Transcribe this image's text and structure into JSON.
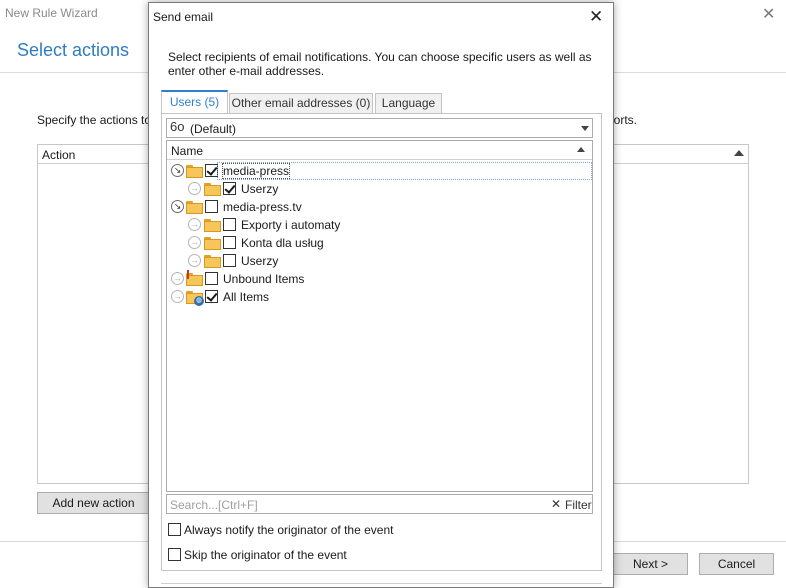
{
  "wizard": {
    "title": "New Rule Wizard",
    "heading": "Select actions",
    "description": "Specify the actions to c",
    "description_tail": "ports.",
    "list_column": "Action",
    "add_button": "Add new action",
    "next_button": "Next >",
    "cancel_button": "Cancel"
  },
  "dialog": {
    "title": "Send email",
    "description": "Select recipients of email notifications. You can choose specific users as well as enter other e-mail addresses.",
    "tabs": [
      {
        "label": "Users (5)",
        "active": true
      },
      {
        "label": "Other email addresses (0)",
        "active": false
      },
      {
        "label": "Language",
        "active": false
      }
    ],
    "profile_selected": "(Default)",
    "tree_column": "Name",
    "tree": [
      {
        "label": "media-press",
        "checked": true,
        "selected": true
      },
      {
        "label": "Userzy",
        "checked": true
      },
      {
        "label": "media-press.tv",
        "checked": false
      },
      {
        "label": "Exporty i automaty",
        "checked": false
      },
      {
        "label": "Konta dla usług",
        "checked": false
      },
      {
        "label": "Userzy",
        "checked": false
      },
      {
        "label": "Unbound Items",
        "checked": false
      },
      {
        "label": "All Items",
        "checked": true
      }
    ],
    "search_placeholder": "Search...[Ctrl+F]",
    "filter_label": "Filter",
    "options": [
      {
        "label": "Always notify the originator of the event",
        "checked": false
      },
      {
        "label": "Skip the originator of the event",
        "checked": false
      }
    ]
  },
  "colors": {
    "accent": "#2f7fd0",
    "heading": "#2e7cc2",
    "folder": "#f6c65a"
  }
}
